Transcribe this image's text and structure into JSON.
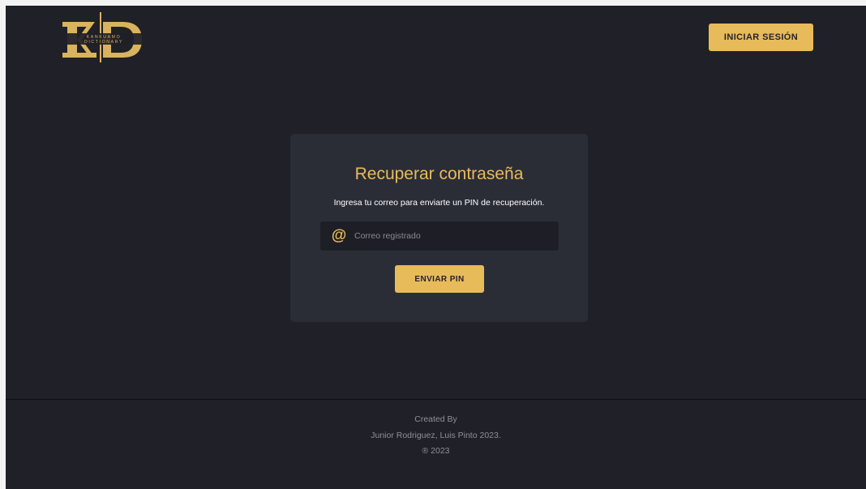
{
  "logo": {
    "letters": "KD",
    "line1": "KANKUAMO",
    "line2": "DICTIONARY"
  },
  "header": {
    "login_label": "INICIAR SESIÓN"
  },
  "card": {
    "title": "Recuperar contraseña",
    "description": "Ingresa tu correo para enviarte un PIN de recuperación.",
    "email_placeholder": "Correo registrado",
    "email_value": "",
    "email_icon": "at-sign-icon",
    "send_label": "ENVIAR PIN"
  },
  "footer": {
    "line1": "Created By",
    "line2": "Junior Rodriguez, Luis Pinto 2023.",
    "line3": "® 2023"
  },
  "colors": {
    "background": "#202028",
    "card": "#2b2d36",
    "accent": "#e8bb5a",
    "input": "#1e1f26"
  }
}
